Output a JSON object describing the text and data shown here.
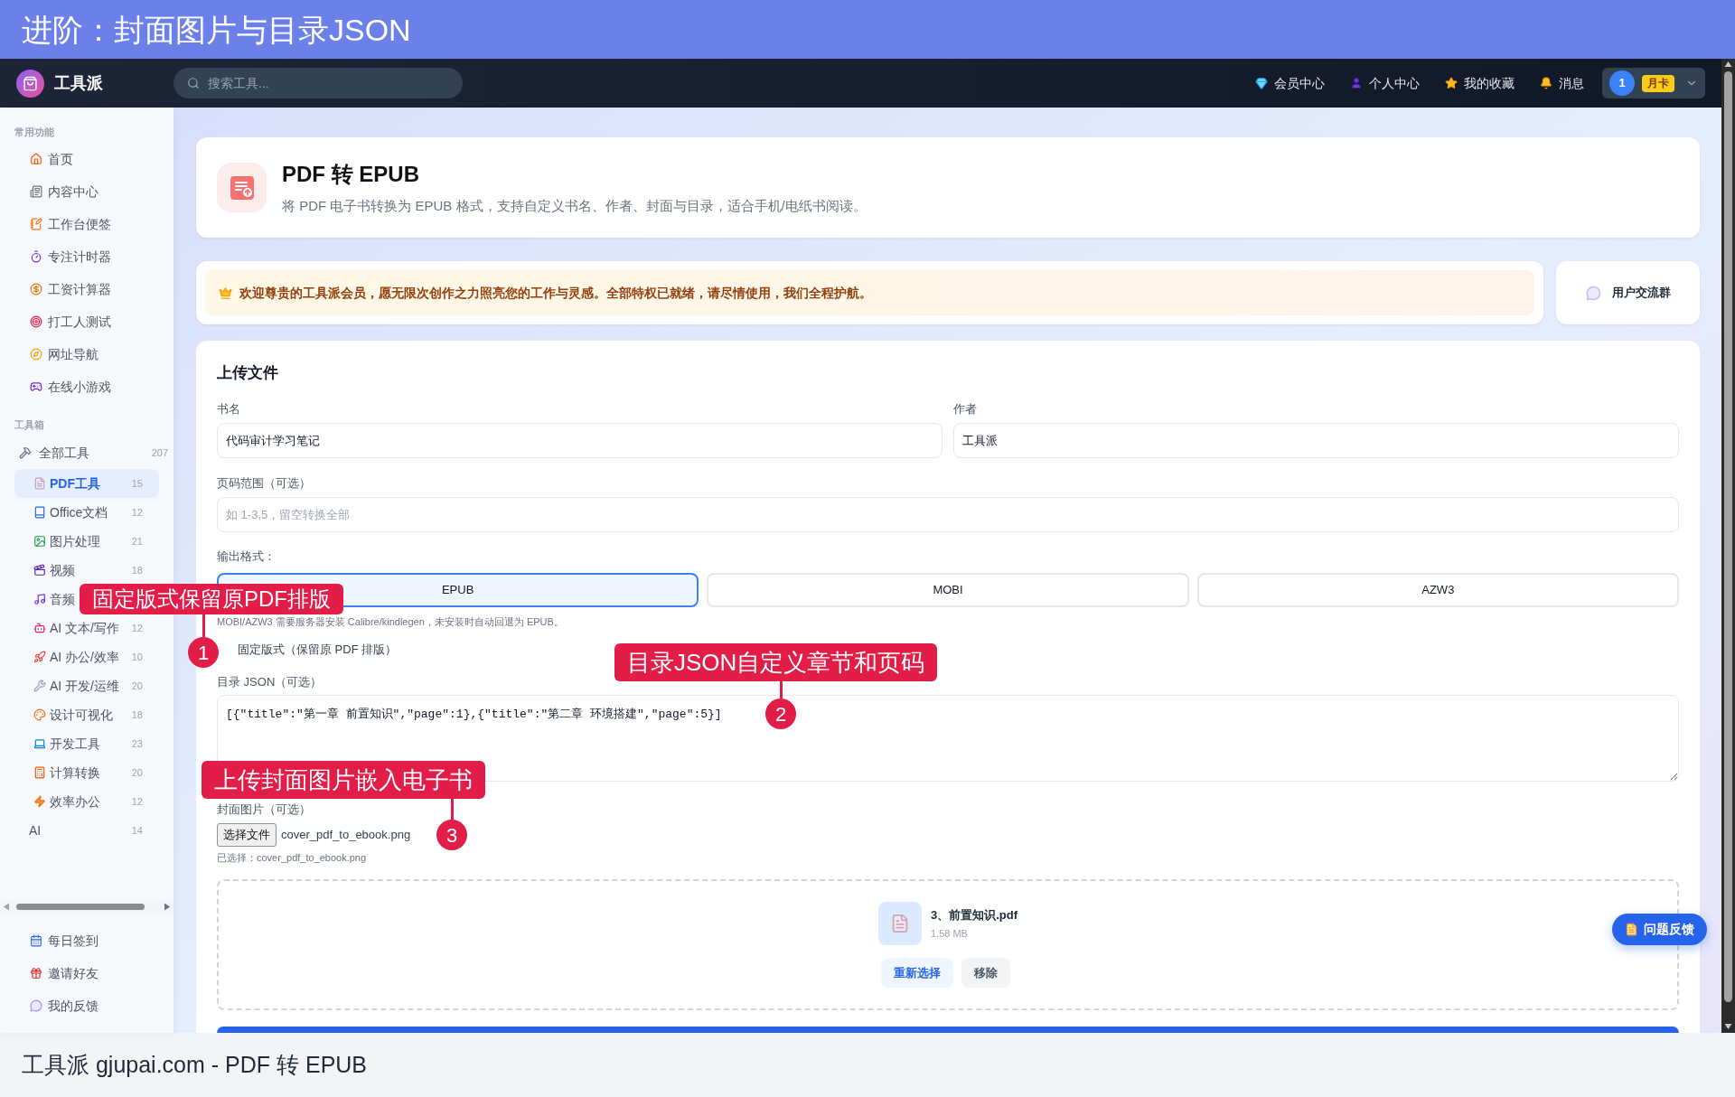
{
  "banner": {
    "title": "进阶：封面图片与目录JSON"
  },
  "navbar": {
    "brand": "工具派",
    "search": {
      "placeholder": "搜索工具..."
    },
    "links": [
      "会员中心",
      "个人中心",
      "我的收藏",
      "消息"
    ],
    "user": {
      "avatar": "1",
      "badge": "月卡"
    }
  },
  "sidebar": {
    "sections": [
      {
        "heading": "常用功能",
        "items": [
          {
            "label": "首页",
            "selected": false
          },
          {
            "label": "内容中心",
            "selected": false
          },
          {
            "label": "工作台便签",
            "selected": false
          },
          {
            "label": "专注计时器",
            "selected": false
          },
          {
            "label": "工资计算器",
            "selected": false
          },
          {
            "label": "打工人测试",
            "selected": false
          },
          {
            "label": "网址导航",
            "selected": false
          },
          {
            "label": "在线小游戏",
            "selected": false
          }
        ]
      },
      {
        "heading": "工具箱",
        "items": [
          {
            "label": "全部工具",
            "count": "207",
            "selected": false,
            "children": [
              {
                "label": "PDF工具",
                "count": "15",
                "selected": true
              },
              {
                "label": "Office文档",
                "count": "12",
                "selected": false
              },
              {
                "label": "图片处理",
                "count": "21",
                "selected": false
              },
              {
                "label": "视频",
                "count": "18",
                "selected": false
              },
              {
                "label": "音频",
                "selected": false
              },
              {
                "label": "AI 文本/写作",
                "count": "12",
                "selected": false
              },
              {
                "label": "AI 办公/效率",
                "count": "10",
                "selected": false
              },
              {
                "label": "AI 开发/运维",
                "count": "20",
                "selected": false
              },
              {
                "label": "设计可视化",
                "count": "18",
                "selected": false
              },
              {
                "label": "开发工具",
                "count": "23",
                "selected": false
              },
              {
                "label": "计算转换",
                "count": "20",
                "selected": false
              },
              {
                "label": "效率办公",
                "count": "12",
                "selected": false
              },
              {
                "label": "AI",
                "count": "14",
                "selected": false
              }
            ]
          }
        ]
      }
    ],
    "footer_items": [
      {
        "label": "每日签到",
        "selected": false
      },
      {
        "label": "邀请好友",
        "selected": false
      },
      {
        "label": "我的反馈",
        "selected": false
      }
    ]
  },
  "header": {
    "title": "PDF 转 EPUB",
    "description": "将 PDF 电子书转换为 EPUB 格式，支持自定义书名、作者、封面与目录，适合手机/电纸书阅读。"
  },
  "welcome": {
    "message": "欢迎尊贵的工具派会员，愿无限次创作之力照亮您的工作与灵感。全部特权已就绪，请尽情使用，我们全程护航。",
    "group_button": "用户交流群"
  },
  "upload": {
    "title": "上传文件",
    "book_title": {
      "label": "书名",
      "value": "代码审计学习笔记"
    },
    "author": {
      "label": "作者",
      "value": "工具派"
    },
    "page_range": {
      "label": "页码范围（可选）",
      "placeholder": "如 1-3,5，留空转换全部"
    },
    "output_format": {
      "label": "输出格式：",
      "options": [
        {
          "label": "EPUB",
          "selected": true
        },
        {
          "label": "MOBI",
          "selected": false
        },
        {
          "label": "AZW3",
          "selected": false
        }
      ],
      "note": "MOBI/AZW3 需要服务器安装 Calibre/kindlegen，未安装时自动回退为 EPUB。"
    },
    "fixed_layout": {
      "label": "固定版式（保留原 PDF 排版）"
    },
    "toc_json": {
      "label": "目录 JSON（可选）",
      "value": "[{\"title\":\"第一章 前置知识\",\"page\":1},{\"title\":\"第二章 环境搭建\",\"page\":5}]"
    },
    "cover": {
      "label": "封面图片（可选）",
      "button": "选择文件",
      "file_name": "cover_pdf_to_ebook.png",
      "status": "已选择：cover_pdf_to_ebook.png"
    },
    "dropzone": {
      "file_name": "3、前置知识.pdf",
      "size": "1.58 MB",
      "buttons": [
        {
          "label": "重新选择",
          "kind": "primary"
        },
        {
          "label": "移除",
          "kind": "secondary"
        }
      ]
    }
  },
  "feedback_button": {
    "label": "问题反馈"
  },
  "annotations": [
    {
      "number": "1",
      "text": "固定版式保留原PDF排版"
    },
    {
      "number": "2",
      "text": "目录JSON自定义章节和页码"
    },
    {
      "number": "3",
      "text": "上传封面图片嵌入电子书"
    }
  ],
  "caption": {
    "text": "工具派 gjupai.com - PDF 转 EPUB"
  }
}
